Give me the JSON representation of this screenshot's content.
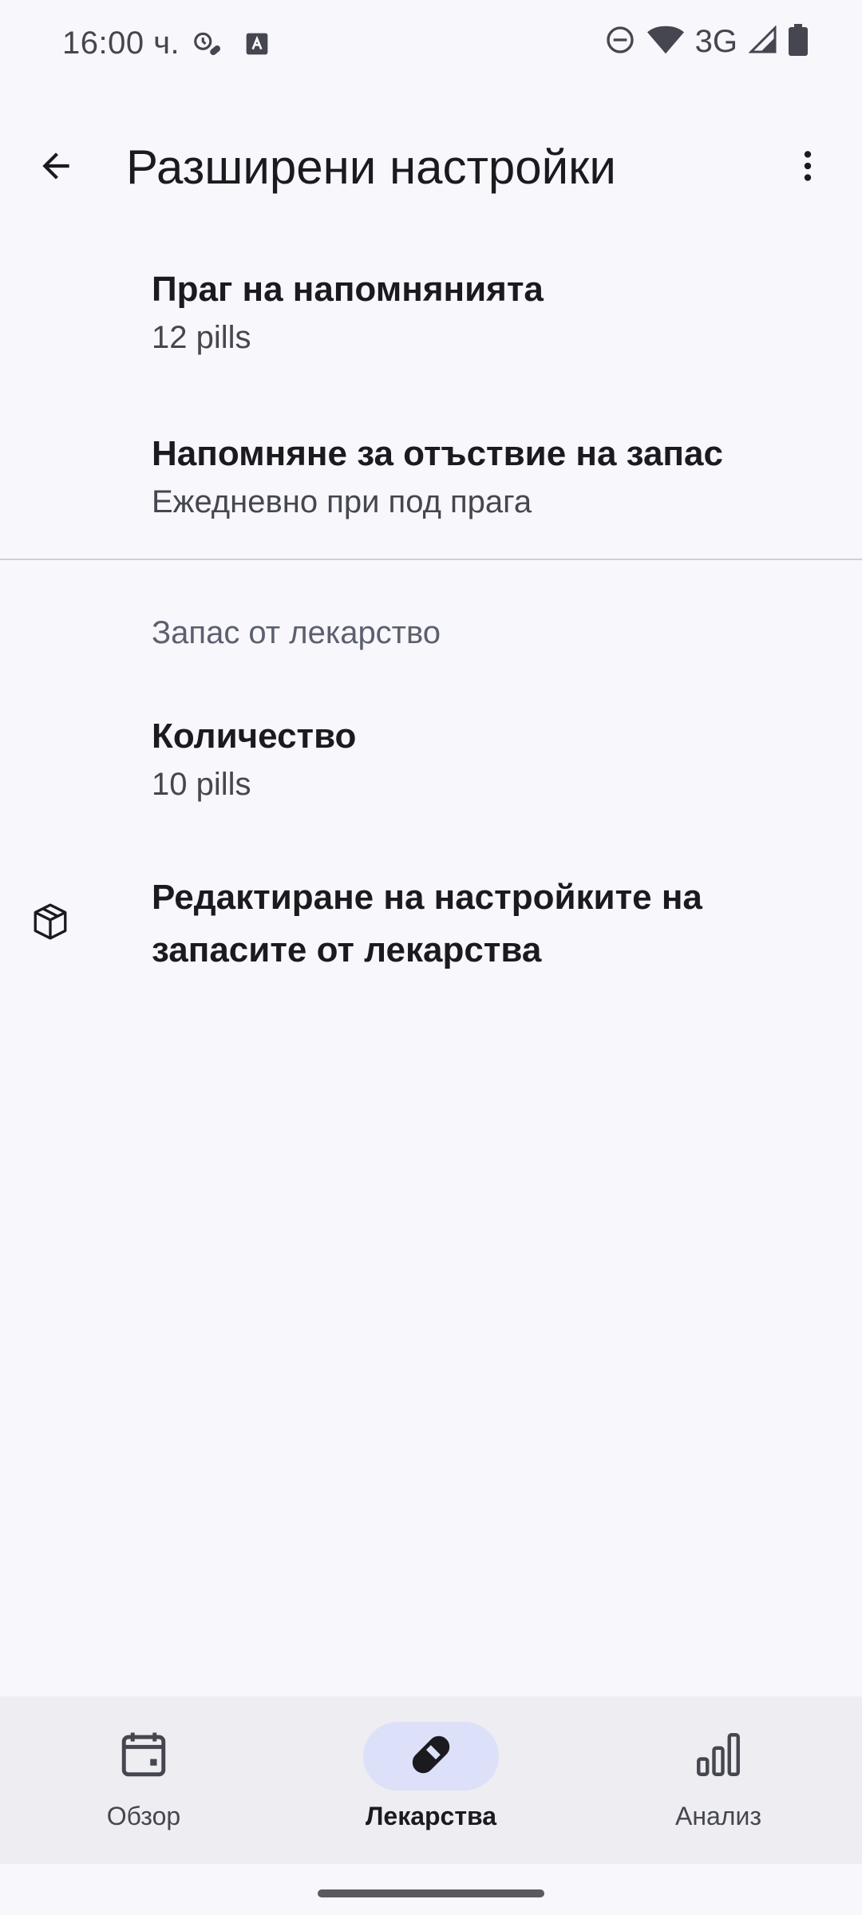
{
  "status_bar": {
    "time": "16:00 ч.",
    "network": "3G",
    "icons": [
      "alarm-pill-icon",
      "keyboard-a-icon",
      "do-not-disturb-icon",
      "wifi-icon",
      "signal-icon",
      "battery-icon"
    ]
  },
  "top_bar": {
    "title": "Разширени настройки",
    "back_icon": "arrow-back-icon",
    "menu_icon": "more-vert-icon"
  },
  "preferences": [
    {
      "title": "Праг на напомнянията",
      "summary": "12 pills"
    },
    {
      "title": "Напомняне за отъствие на запас",
      "summary": "Ежедневно при под прага"
    }
  ],
  "stock_section": {
    "category": "Запас от лекарство",
    "quantity": {
      "title": "Количество",
      "summary": "10 pills"
    },
    "edit": {
      "title": "Редактиране на настройките на запасите от лекарства",
      "icon": "box-icon"
    }
  },
  "bottom_nav": {
    "items": [
      {
        "label": "Обзор",
        "icon": "calendar-icon",
        "active": false
      },
      {
        "label": "Лекарства",
        "icon": "pill-icon",
        "active": true
      },
      {
        "label": "Анализ",
        "icon": "bar-chart-icon",
        "active": false
      }
    ]
  },
  "colors": {
    "background": "#F7F7FC",
    "nav_background": "#EDEDF2",
    "active_indicator": "#DCE1F9",
    "text_primary": "#1B1B1F",
    "text_secondary": "#45464F"
  }
}
